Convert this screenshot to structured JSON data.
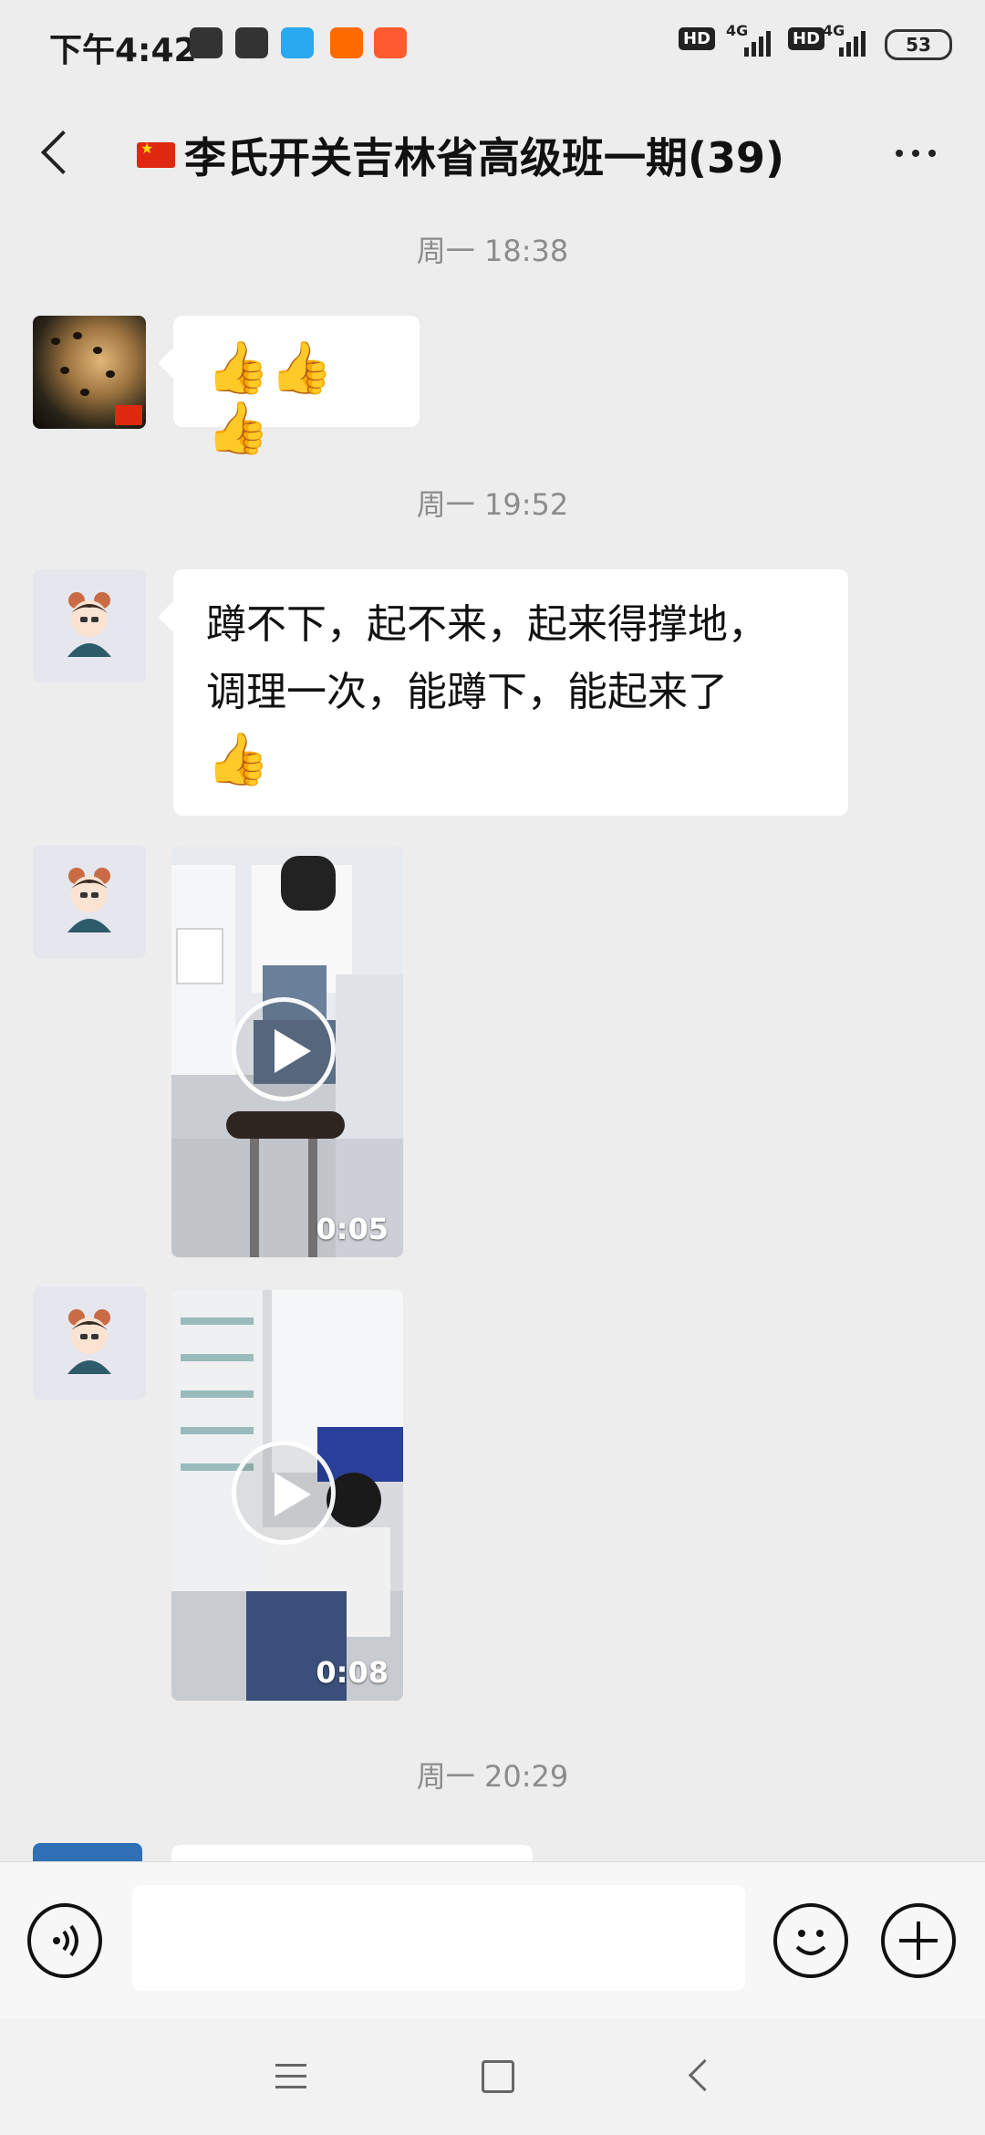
{
  "status_bar": {
    "time": "下午4:42",
    "network_label_1": "HD",
    "network_label_2": "HD",
    "net_type_1": "4G",
    "net_type_2": "4G",
    "battery": "53"
  },
  "header": {
    "title": "李氏开关吉林省高级班一期(39)"
  },
  "timestamps": [
    "周一 18:38",
    "周一 19:52",
    "周一 20:29"
  ],
  "messages": {
    "m1": {
      "content": "👍👍👍"
    },
    "m2": {
      "line1": "蹲不下，起不来，起来得撑地，",
      "line2": "调理一次，能蹲下，能起来了",
      "emoji": "👍"
    },
    "video1": {
      "duration": "0:05"
    },
    "video2": {
      "duration": "0:08"
    }
  },
  "colors": {
    "background": "#ededed",
    "bubble": "#ffffff",
    "accent": "#de2910"
  }
}
